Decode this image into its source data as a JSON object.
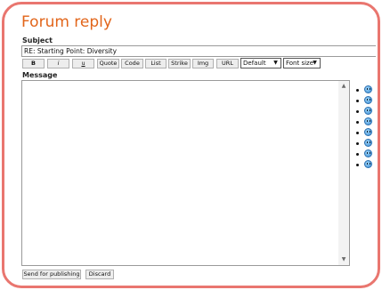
{
  "page": {
    "title": "Forum reply"
  },
  "subject": {
    "label": "Subject",
    "value": "RE: Starting Point: Diversity"
  },
  "toolbar": {
    "buttons": [
      {
        "label": "B"
      },
      {
        "label": "i"
      },
      {
        "label": "u"
      },
      {
        "label": "Quote"
      },
      {
        "label": "Code"
      },
      {
        "label": "List"
      },
      {
        "label": "Strike"
      },
      {
        "label": "Img"
      },
      {
        "label": "URL"
      }
    ],
    "font_select": "Default",
    "size_select": "Font size"
  },
  "message": {
    "label": "Message",
    "value": ""
  },
  "smileys": [
    "smile-icon",
    "wink-icon",
    "grin-icon",
    "sad-icon",
    "tongue-icon",
    "cool-icon",
    "surprised-icon",
    "happy-icon"
  ],
  "actions": {
    "send_label": "Send for publishing",
    "discard_label": "Discard"
  },
  "colors": {
    "frame": "#e9766f",
    "title": "#e2651a",
    "smiley": "#3a8fd6"
  }
}
